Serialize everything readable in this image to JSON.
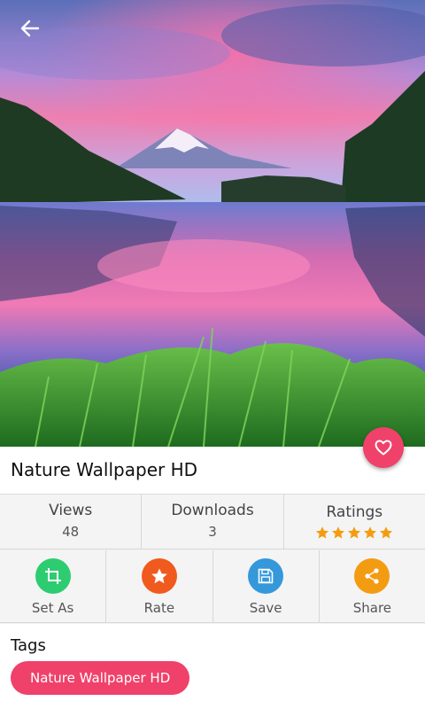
{
  "wallpaper": {
    "title": "Nature Wallpaper HD"
  },
  "stats": {
    "views_label": "Views",
    "views_value": "48",
    "downloads_label": "Downloads",
    "downloads_value": "3",
    "ratings_label": "Ratings",
    "rating_stars": 5
  },
  "actions": [
    {
      "label": "Set As",
      "icon": "crop-icon",
      "color": "#2ecc71"
    },
    {
      "label": "Rate",
      "icon": "star-icon",
      "color": "#f05a1e"
    },
    {
      "label": "Save",
      "icon": "save-icon",
      "color": "#3498db"
    },
    {
      "label": "Share",
      "icon": "share-icon",
      "color": "#f39c12"
    }
  ],
  "tags": {
    "title": "Tags",
    "items": [
      "Nature Wallpaper HD"
    ]
  },
  "colors": {
    "accent": "#f0416a",
    "star": "#f39c12"
  }
}
